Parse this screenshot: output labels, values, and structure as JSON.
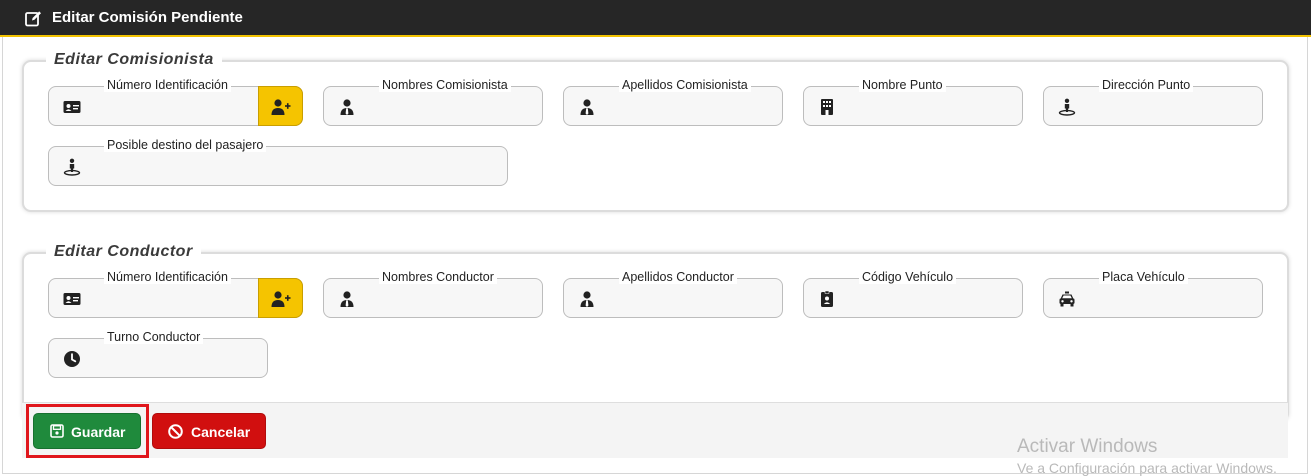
{
  "header": {
    "title": "Editar Comisión Pendiente",
    "icon": "edit-icon"
  },
  "comisionista": {
    "legend": "Editar Comisionista",
    "fields": {
      "numero": {
        "label": "Número Identificación",
        "value": "",
        "icon": "id-card-icon"
      },
      "nombres": {
        "label": "Nombres Comisionista",
        "value": "",
        "icon": "user-tie-icon"
      },
      "apellidos": {
        "label": "Apellidos Comisionista",
        "value": "",
        "icon": "user-tie-icon"
      },
      "punto": {
        "label": "Nombre Punto",
        "value": "",
        "icon": "building-icon"
      },
      "direccion": {
        "label": "Dirección Punto",
        "value": "",
        "icon": "street-view-icon"
      },
      "destino": {
        "label": "Posible destino del pasajero",
        "value": "",
        "icon": "street-view-icon"
      }
    }
  },
  "conductor": {
    "legend": "Editar Conductor",
    "fields": {
      "numero": {
        "label": "Número Identificación",
        "value": "",
        "icon": "id-card-icon"
      },
      "nombres": {
        "label": "Nombres Conductor",
        "value": "",
        "icon": "user-tie-icon"
      },
      "apellidos": {
        "label": "Apellidos Conductor",
        "value": "",
        "icon": "user-tie-icon"
      },
      "codigo": {
        "label": "Código Vehículo",
        "value": "",
        "icon": "id-badge-icon"
      },
      "placa": {
        "label": "Placa Vehículo",
        "value": "",
        "icon": "taxi-icon"
      },
      "turno": {
        "label": "Turno Conductor",
        "value": "",
        "icon": "clock-icon"
      }
    }
  },
  "actions": {
    "save_label": "Guardar",
    "cancel_label": "Cancelar"
  },
  "watermark": {
    "line1": "Activar Windows",
    "line2": "Ve a Configuración para activar Windows."
  },
  "colors": {
    "header_bg": "#262626",
    "accent_yellow": "#f5c400",
    "save_green": "#1f8a3c",
    "cancel_red": "#d10f0f"
  }
}
